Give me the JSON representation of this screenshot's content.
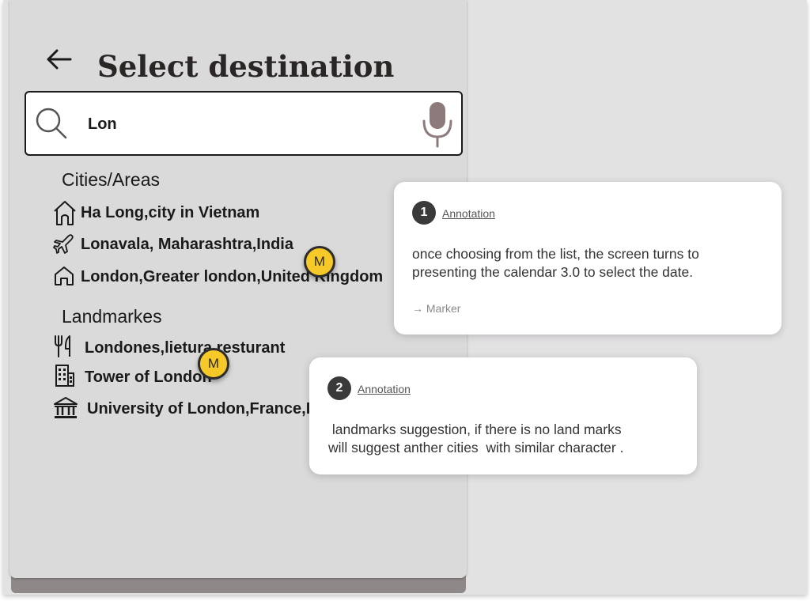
{
  "header": {
    "title": "Select destination"
  },
  "search": {
    "value": "Lon"
  },
  "sections": {
    "cities": {
      "heading": "Cities/Areas",
      "items": [
        {
          "label": "Ha Long,city in Vietnam",
          "icon": "house-icon"
        },
        {
          "label": "Lonavala, Maharashtra,India",
          "icon": "airplane-icon"
        },
        {
          "label": "London,Greater london,United Kingdom",
          "icon": "home-icon"
        }
      ]
    },
    "landmarks": {
      "heading": "Landmarkes",
      "items": [
        {
          "label": "Londones,lietura resturant",
          "icon": "fork-knife-icon"
        },
        {
          "label": "Tower of London",
          "icon": "building-icon"
        },
        {
          "label": "University of London,France,Paris",
          "icon": "institution-icon"
        }
      ]
    }
  },
  "markers": [
    {
      "label": "M"
    },
    {
      "label": "M"
    }
  ],
  "annotations": [
    {
      "number": "1",
      "link": "Annotation",
      "text": "once choosing from the list, the screen turns to\npresenting the calendar 3.0 to select the date.",
      "reference": "→ Marker"
    },
    {
      "number": "2",
      "link": "Annotation",
      "text": " landmarks suggestion, if there is no land marks\nwill suggest anther cities  with similar character ."
    }
  ],
  "colors": {
    "marker": "#f7c928",
    "phone_background": "#dadada",
    "canvas_background": "#e3e2e3"
  }
}
